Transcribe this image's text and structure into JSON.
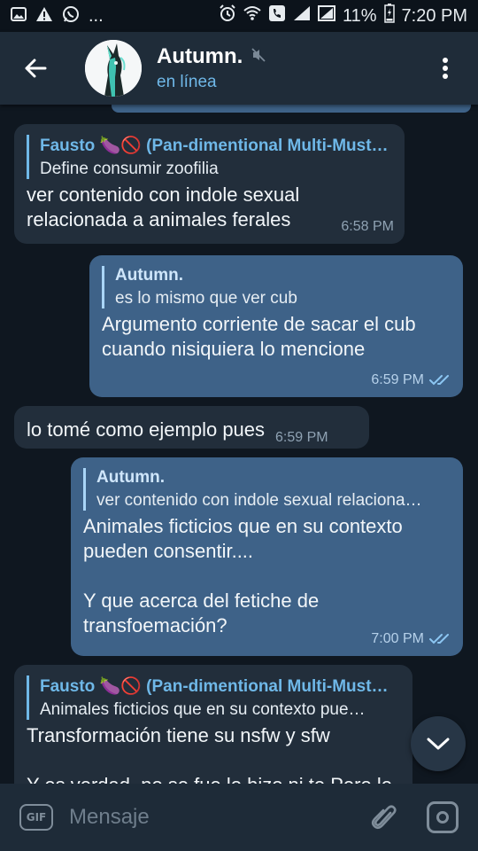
{
  "statusbar": {
    "left_icons": [
      "image-icon",
      "alert-icon",
      "whatsapp-icon",
      "more-icon"
    ],
    "more": "...",
    "battery": "11%",
    "time": "7:20 PM"
  },
  "header": {
    "title": "Autumn.",
    "status": "en línea"
  },
  "messages": [
    {
      "direction": "in",
      "quote_name": "Fausto 🍆🚫 (Pan-dimentional Multi-Must…",
      "quote_text": "Define consumir zoofilia",
      "text": "ver contenido con indole sexual\nrelacionada a animales ferales",
      "time": "6:58 PM"
    },
    {
      "direction": "out",
      "quote_name": "Autumn.",
      "quote_text": "es lo mismo que ver cub",
      "text": "Argumento corriente de sacar el cub\ncuando nisiquiera lo mencione",
      "time": "6:59 PM",
      "read": true
    },
    {
      "direction": "in",
      "text": "lo tomé como ejemplo pues",
      "time": "6:59 PM"
    },
    {
      "direction": "out",
      "quote_name": "Autumn.",
      "quote_text": "ver contenido con indole sexual relaciona…",
      "text": "Animales ficticios que en su contexto\npueden consentir....\n\nY que acerca del fetiche de\ntransfoemación?",
      "time": "7:00 PM",
      "read": true
    },
    {
      "direction": "in",
      "quote_name": "Fausto 🍆🚫 (Pan-dimentional Multi-Must…",
      "quote_text": "Animales ficticios que en su contexto pue…",
      "text": "Transformación tiene su nsfw y sfw\n\nY es verdad, no se fue lo hizo ni te Pero le",
      "time": ""
    }
  ],
  "input": {
    "gif_label": "GIF",
    "placeholder": "Mensaje"
  },
  "colors": {
    "accent": "#6fb8e8",
    "outgoing_bubble": "#3e6288",
    "incoming_bubble": "#222e3b",
    "background": "#0f1720",
    "header": "#1f2c39"
  }
}
